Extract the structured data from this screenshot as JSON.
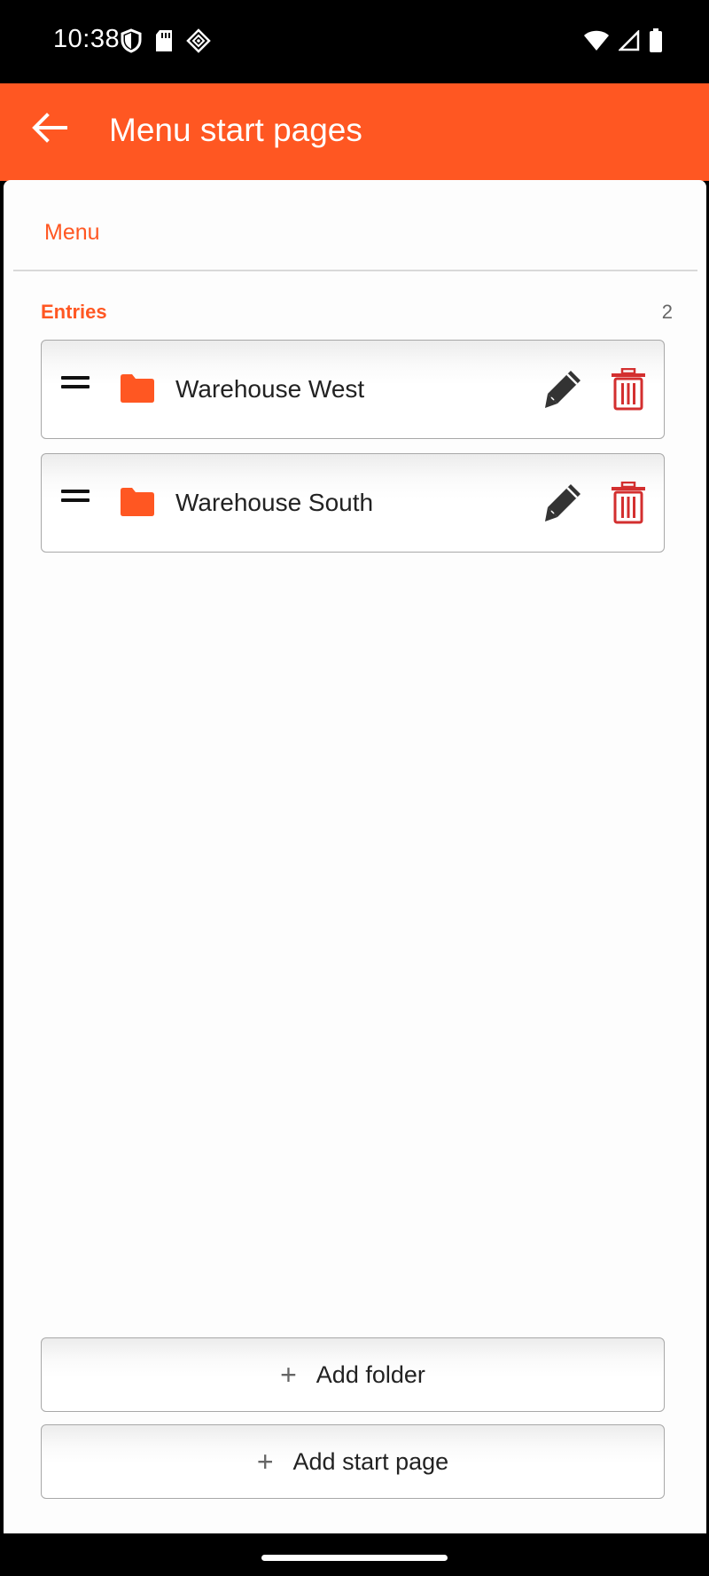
{
  "status_bar": {
    "time": "10:38",
    "icons_left": [
      "shield-icon",
      "sd-card-icon",
      "diamond-app-icon"
    ],
    "icons_right": [
      "wifi-icon",
      "cellular-signal-icon",
      "battery-icon"
    ]
  },
  "app_bar": {
    "title": "Menu start pages",
    "back_icon": "arrow-left-icon",
    "color": "#ff5722"
  },
  "tab": {
    "label": "Menu"
  },
  "entries_section": {
    "title": "Entries",
    "count": "2",
    "items": [
      {
        "label": "Warehouse West",
        "icon": "folder-icon"
      },
      {
        "label": "Warehouse South",
        "icon": "folder-icon"
      }
    ]
  },
  "actions": {
    "add_folder": "Add folder",
    "add_start_page": "Add start page"
  },
  "colors": {
    "accent": "#ff5722",
    "delete": "#d32f2f",
    "edit": "#333333"
  }
}
